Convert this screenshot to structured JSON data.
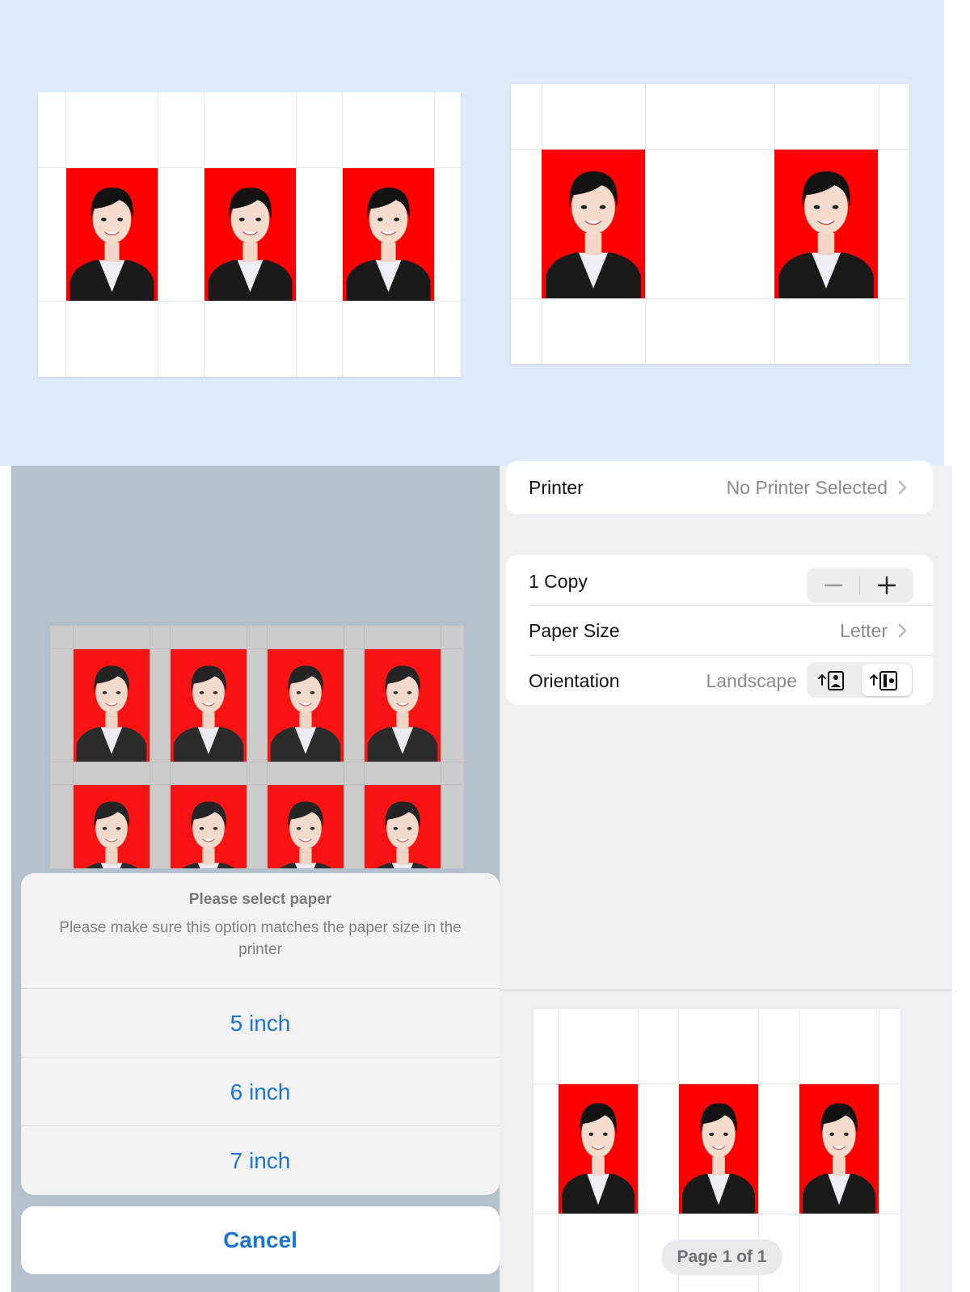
{
  "print_options": {
    "printer_label": "Printer",
    "printer_value": "No Printer Selected",
    "copies_label": "1 Copy",
    "paper_size_label": "Paper Size",
    "paper_size_value": "Letter",
    "orientation_label": "Orientation",
    "orientation_value": "Landscape"
  },
  "action_sheet": {
    "title": "Please select paper",
    "message": "Please make sure this option matches the paper size in the printer",
    "options": [
      {
        "label": "5 inch"
      },
      {
        "label": "6 inch"
      },
      {
        "label": "7 inch"
      }
    ],
    "cancel_label": "Cancel"
  },
  "preview": {
    "page_indicator": "Page 1 of 1"
  },
  "colors": {
    "accent_blue": "#1a76d2",
    "photo_background": "#ff0000",
    "top_background": "#dfeafc"
  }
}
